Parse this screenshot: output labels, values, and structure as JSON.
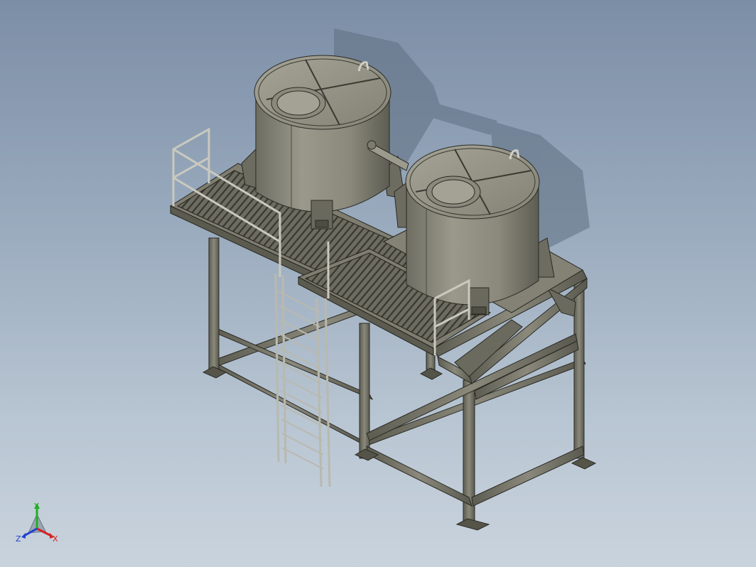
{
  "viewport": {
    "background_top": "#7c8ea6",
    "background_bottom": "#c9d3dd",
    "model_color": "#7d7d6e",
    "tank_color": "#8e8d80"
  },
  "triad": {
    "x_label": "X",
    "y_label": "Y",
    "z_label": "Z",
    "x_color": "#d42020",
    "y_color": "#20b020",
    "z_color": "#2040d0"
  }
}
